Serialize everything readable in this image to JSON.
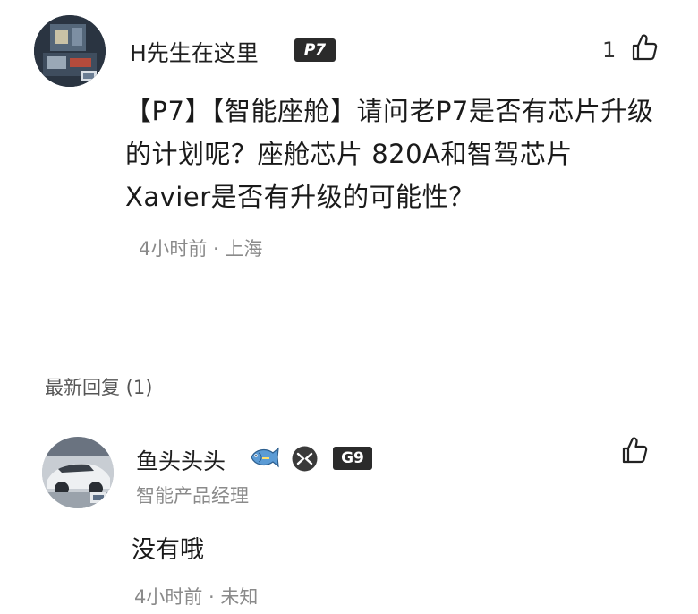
{
  "comment": {
    "username": "H先生在这里",
    "badge": "P7",
    "likes": "1",
    "content": "【P7】【智能座舱】请问老P7是否有芯片升级的计划呢？座舱芯片 820A和智驾芯片 Xavier是否有升级的可能性？",
    "meta": "4小时前 · 上海",
    "icons": {
      "like": "thumbs-up-icon"
    }
  },
  "replies": {
    "header": "最新回复 (1)",
    "items": [
      {
        "username": "鱼头头头",
        "badge": "G9",
        "title": "智能产品经理",
        "content": "没有哦",
        "meta": "4小时前 · 未知",
        "icons": {
          "decoration": "fish-icon",
          "brand": "xpeng-logo-icon",
          "like": "thumbs-up-icon"
        }
      }
    ]
  },
  "colors": {
    "text": "#1a1a1a",
    "meta": "#8a8a8a",
    "badge_bg": "#2b2b2b"
  }
}
